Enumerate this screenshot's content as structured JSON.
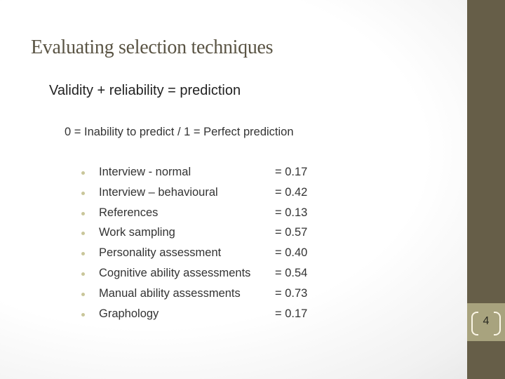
{
  "slide": {
    "title": "Evaluating selection techniques",
    "subtitle": "Validity + reliability = prediction",
    "scale_note": "0 = Inability to predict / 1 = Perfect prediction",
    "items": [
      {
        "label": "Interview - normal",
        "value": "= 0.17"
      },
      {
        "label": "Interview – behavioural",
        "value": "= 0.42"
      },
      {
        "label": "References",
        "value": "= 0.13"
      },
      {
        "label": "Work sampling",
        "value": "= 0.57"
      },
      {
        "label": "Personality assessment",
        "value": "= 0.40"
      },
      {
        "label": "Cognitive ability assessments",
        "value": "= 0.54"
      },
      {
        "label": "Manual ability assessments",
        "value": "= 0.73"
      },
      {
        "label": "Graphology",
        "value": "= 0.17"
      }
    ],
    "page_number": "4"
  },
  "colors": {
    "sidebar": "#665e48",
    "page_box": "#a8a37e",
    "title": "#5a5444",
    "bullet": "#c9c69a"
  }
}
